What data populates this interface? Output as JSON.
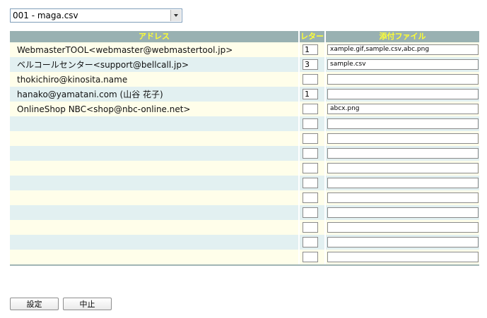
{
  "file_select": {
    "value": "001 - maga.csv"
  },
  "table": {
    "headers": {
      "address": "アドレス",
      "letter": "レター",
      "attachment": "添付ファイル"
    },
    "rows": [
      {
        "address": "WebmasterTOOL<webmaster@webmastertool.jp>",
        "letter": "1",
        "attachment": "xample.gif,sample.csv,abc.png"
      },
      {
        "address": "ベルコールセンター<support@bellcall.jp>",
        "letter": "3",
        "attachment": "sample.csv"
      },
      {
        "address": "thokichiro@kinosita.name",
        "letter": "",
        "attachment": ""
      },
      {
        "address": "hanako@yamatani.com (山谷 花子)",
        "letter": "1",
        "attachment": ""
      },
      {
        "address": "OnlineShop NBC<shop@nbc-online.net>",
        "letter": "",
        "attachment": "abcx.png"
      },
      {
        "address": "",
        "letter": "",
        "attachment": ""
      },
      {
        "address": "",
        "letter": "",
        "attachment": ""
      },
      {
        "address": "",
        "letter": "",
        "attachment": ""
      },
      {
        "address": "",
        "letter": "",
        "attachment": ""
      },
      {
        "address": "",
        "letter": "",
        "attachment": ""
      },
      {
        "address": "",
        "letter": "",
        "attachment": ""
      },
      {
        "address": "",
        "letter": "",
        "attachment": ""
      },
      {
        "address": "",
        "letter": "",
        "attachment": ""
      },
      {
        "address": "",
        "letter": "",
        "attachment": ""
      },
      {
        "address": "",
        "letter": "",
        "attachment": ""
      }
    ]
  },
  "buttons": {
    "set": "設定",
    "cancel": "中止"
  }
}
